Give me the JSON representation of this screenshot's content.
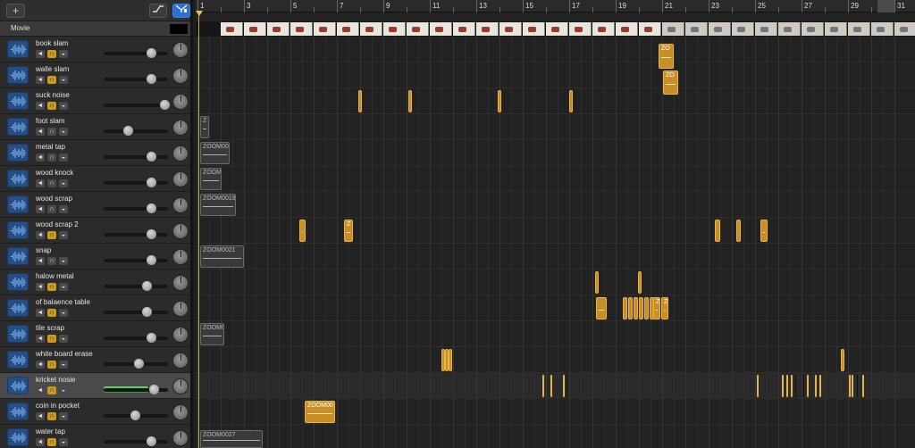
{
  "header": {
    "add_track_label": "+",
    "automation_icon": "automation-curve-icon",
    "filter_icon": "catch-filter-icon",
    "movie_label": "Movie"
  },
  "ruler": {
    "bars": [
      "1",
      "3",
      "5",
      "7",
      "9",
      "11",
      "13",
      "15",
      "17",
      "19",
      "21",
      "23",
      "25",
      "27",
      "29",
      "31"
    ]
  },
  "tracks": [
    {
      "name": "book slam",
      "volume": 0.72,
      "solo": true
    },
    {
      "name": "walle slam",
      "volume": 0.72,
      "solo": true
    },
    {
      "name": "suck noise",
      "volume": 0.95,
      "solo": true
    },
    {
      "name": "foot slam",
      "volume": 0.33,
      "solo": false
    },
    {
      "name": "metal tap",
      "volume": 0.72,
      "solo": false
    },
    {
      "name": "wood knock",
      "volume": 0.72,
      "solo": false
    },
    {
      "name": "wood scrap",
      "volume": 0.72,
      "solo": false
    },
    {
      "name": "wood scrap 2",
      "volume": 0.72,
      "solo": true
    },
    {
      "name": "snap",
      "volume": 0.72,
      "solo": false
    },
    {
      "name": "halow metal",
      "volume": 0.65,
      "solo": true
    },
    {
      "name": "of balaence table",
      "volume": 0.65,
      "solo": true
    },
    {
      "name": "tile scrap",
      "volume": 0.72,
      "solo": true
    },
    {
      "name": "white board erase",
      "volume": 0.52,
      "solo": true
    },
    {
      "name": "kricket nosie",
      "volume": 0.78,
      "solo": true,
      "selected": true,
      "meter": true
    },
    {
      "name": "coin in pocket",
      "volume": 0.45,
      "solo": true
    },
    {
      "name": "water tap",
      "volume": 0.72,
      "solo": true
    }
  ],
  "regions": {
    "book_slam": "ZO",
    "walle_slam": "ZO",
    "foot_slam": "Z",
    "metal_tap": "ZOOM00",
    "wood_knock": "ZOOM",
    "wood_scrap": "ZOOM0019",
    "wood_scrap_2": "Z",
    "snap": "ZOOM0021",
    "balance_a": "Z",
    "balance_b": "Z",
    "tile_scrap": "ZOOM0",
    "coin": "ZOOM00",
    "water": "ZOOM0027"
  },
  "colors": {
    "region_gold": "#c98f24",
    "track_icon_blue": "#254e86",
    "solo_yellow": "#c99a1c",
    "filter_blue": "#2c6fd1"
  }
}
